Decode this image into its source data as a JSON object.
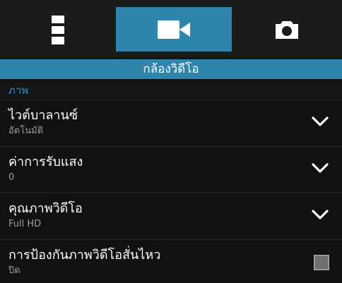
{
  "tabs": [
    {
      "icon": "more-vertical-icon"
    },
    {
      "icon": "video-camera-icon",
      "selected": true
    },
    {
      "icon": "camera-icon"
    }
  ],
  "header": {
    "title": "กล้องวิดีโอ"
  },
  "section": {
    "title": "ภาพ"
  },
  "settings": [
    {
      "title": "ไวต์บาลานซ์",
      "value": "อัตโนมัติ",
      "control": "chevron-down-icon"
    },
    {
      "title": "ค่าการรับแสง",
      "value": "0",
      "control": "chevron-down-icon"
    },
    {
      "title": "คุณภาพวิดีโอ",
      "value": "Full HD",
      "control": "chevron-down-icon"
    },
    {
      "title": "การป้องกันภาพวิดีโอสั่นไหว",
      "value": "ปิด",
      "control": "checkbox",
      "checked": false
    }
  ],
  "colors": {
    "accent": "#2f86ad",
    "section_text": "#2f8fc0",
    "background": "#111111"
  }
}
